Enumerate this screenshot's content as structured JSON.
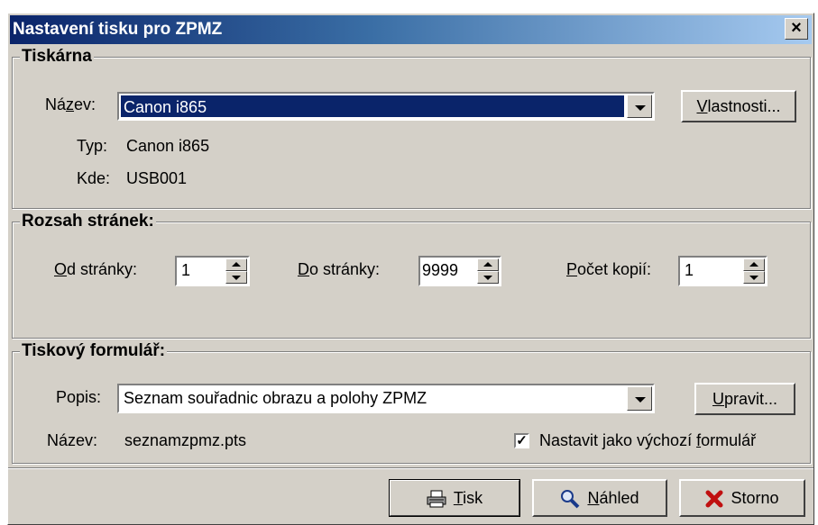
{
  "window": {
    "title": "Nastavení tisku pro ZPMZ",
    "close": "×"
  },
  "printer": {
    "legend": "Tiskárna",
    "name_label_pre": "Ná",
    "name_label_u": "z",
    "name_label_post": "ev:",
    "name_value": "Canon i865",
    "props_u": "V",
    "props_rest": "lastnosti...",
    "type_label": "Typ:",
    "type_value": "Canon i865",
    "where_label": "Kde:",
    "where_value": "USB001"
  },
  "range": {
    "legend": "Rozsah stránek:",
    "from_u": "O",
    "from_rest": "d stránky:",
    "from_value": "1",
    "to_u": "D",
    "to_rest": "o stránky:",
    "to_value": "9999",
    "copies_u": "P",
    "copies_rest": "očet kopií:",
    "copies_value": "1"
  },
  "form": {
    "legend": "Tiskový formulář:",
    "desc_label": "Popis:",
    "desc_value": "Seznam souřadnic obrazu a polohy ZPMZ",
    "edit_u": "U",
    "edit_rest": "pravit...",
    "name_label": "Název:",
    "name_value": "seznamzpmz.pts",
    "default_pre": "Nastavit jako výchozí ",
    "default_u": "f",
    "default_post": "ormulář",
    "default_checked": true
  },
  "buttons": {
    "print_u": "T",
    "print_rest": "isk",
    "preview_u": "N",
    "preview_rest": "áhled",
    "cancel": "Storno"
  }
}
